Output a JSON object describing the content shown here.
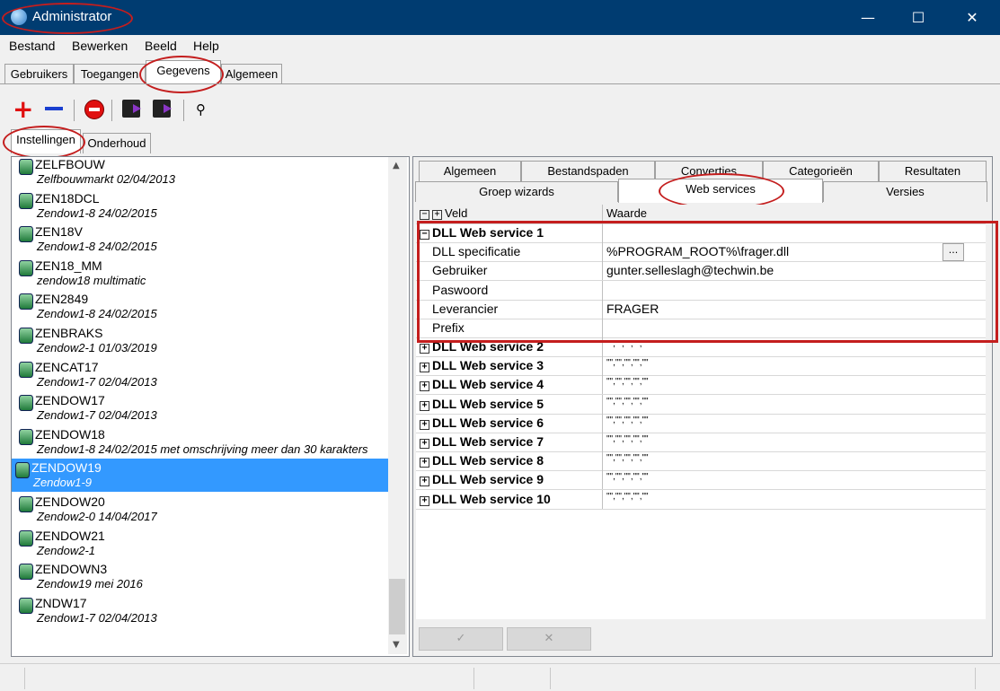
{
  "window": {
    "title": "Administrator",
    "minimize": "—",
    "maximize": "☐",
    "close": "✕"
  },
  "menu": [
    "Bestand",
    "Bewerken",
    "Beeld",
    "Help"
  ],
  "main_tabs": [
    "Gebruikers",
    "Toegangen",
    "Gegevens",
    "Algemeen"
  ],
  "sub_tabs": [
    "Instellingen",
    "Onderhoud"
  ],
  "toolbar_icons": [
    "add-icon",
    "remove-icon",
    "stop-icon",
    "export-icon",
    "import-icon",
    "search-icon"
  ],
  "list": [
    {
      "name": "ZELFBOUW",
      "desc": "Zelfbouwmarkt 02/04/2013"
    },
    {
      "name": "ZEN18DCL",
      "desc": "Zendow1-8 24/02/2015"
    },
    {
      "name": "ZEN18V",
      "desc": "Zendow1-8 24/02/2015"
    },
    {
      "name": "ZEN18_MM",
      "desc": "zendow18 multimatic"
    },
    {
      "name": "ZEN2849",
      "desc": "Zendow1-8 24/02/2015"
    },
    {
      "name": "ZENBRAKS",
      "desc": "Zendow2-1 01/03/2019"
    },
    {
      "name": "ZENCAT17",
      "desc": "Zendow1-7 02/04/2013"
    },
    {
      "name": "ZENDOW17",
      "desc": "Zendow1-7 02/04/2013"
    },
    {
      "name": "ZENDOW18",
      "desc": "Zendow1-8 24/02/2015 met omschrijving meer dan 30 karakters"
    },
    {
      "name": "ZENDOW19",
      "desc": "Zendow1-9"
    },
    {
      "name": "ZENDOW20",
      "desc": "Zendow2-0 14/04/2017"
    },
    {
      "name": "ZENDOW21",
      "desc": "Zendow2-1"
    },
    {
      "name": "ZENDOWN3",
      "desc": "Zendow19 mei 2016"
    },
    {
      "name": "ZNDW17",
      "desc": "Zendow1-7 02/04/2013"
    }
  ],
  "selected_item": "ZENDOW19",
  "right_tabs_row1": [
    "Algemeen",
    "Bestandspaden",
    "Converties",
    "Categorieën",
    "Resultaten"
  ],
  "right_tabs_row2": [
    "Groep wizards",
    "Web services",
    "Versies"
  ],
  "grid": {
    "col_veld": "Veld",
    "col_waarde": "Waarde",
    "expanded_group": "DLL Web service 1",
    "fields": [
      {
        "label": "DLL specificatie",
        "value": "%PROGRAM_ROOT%\\frager.dll"
      },
      {
        "label": "Gebruiker",
        "value": "gunter.selleslagh@techwin.be"
      },
      {
        "label": "Paswoord",
        "value": ""
      },
      {
        "label": "Leverancier",
        "value": "FRAGER"
      },
      {
        "label": "Prefix",
        "value": ""
      }
    ],
    "browse": "...",
    "collapsed_groups": [
      "DLL Web service 2",
      "DLL Web service 3",
      "DLL Web service 4",
      "DLL Web service 5",
      "DLL Web service 6",
      "DLL Web service 7",
      "DLL Web service 8",
      "DLL Web service 9",
      "DLL Web service 10"
    ],
    "collapsed_value": "\"\",\"\",\"\",\"\",\"\""
  },
  "buttons": {
    "ok": "✓",
    "cancel": "✕"
  }
}
